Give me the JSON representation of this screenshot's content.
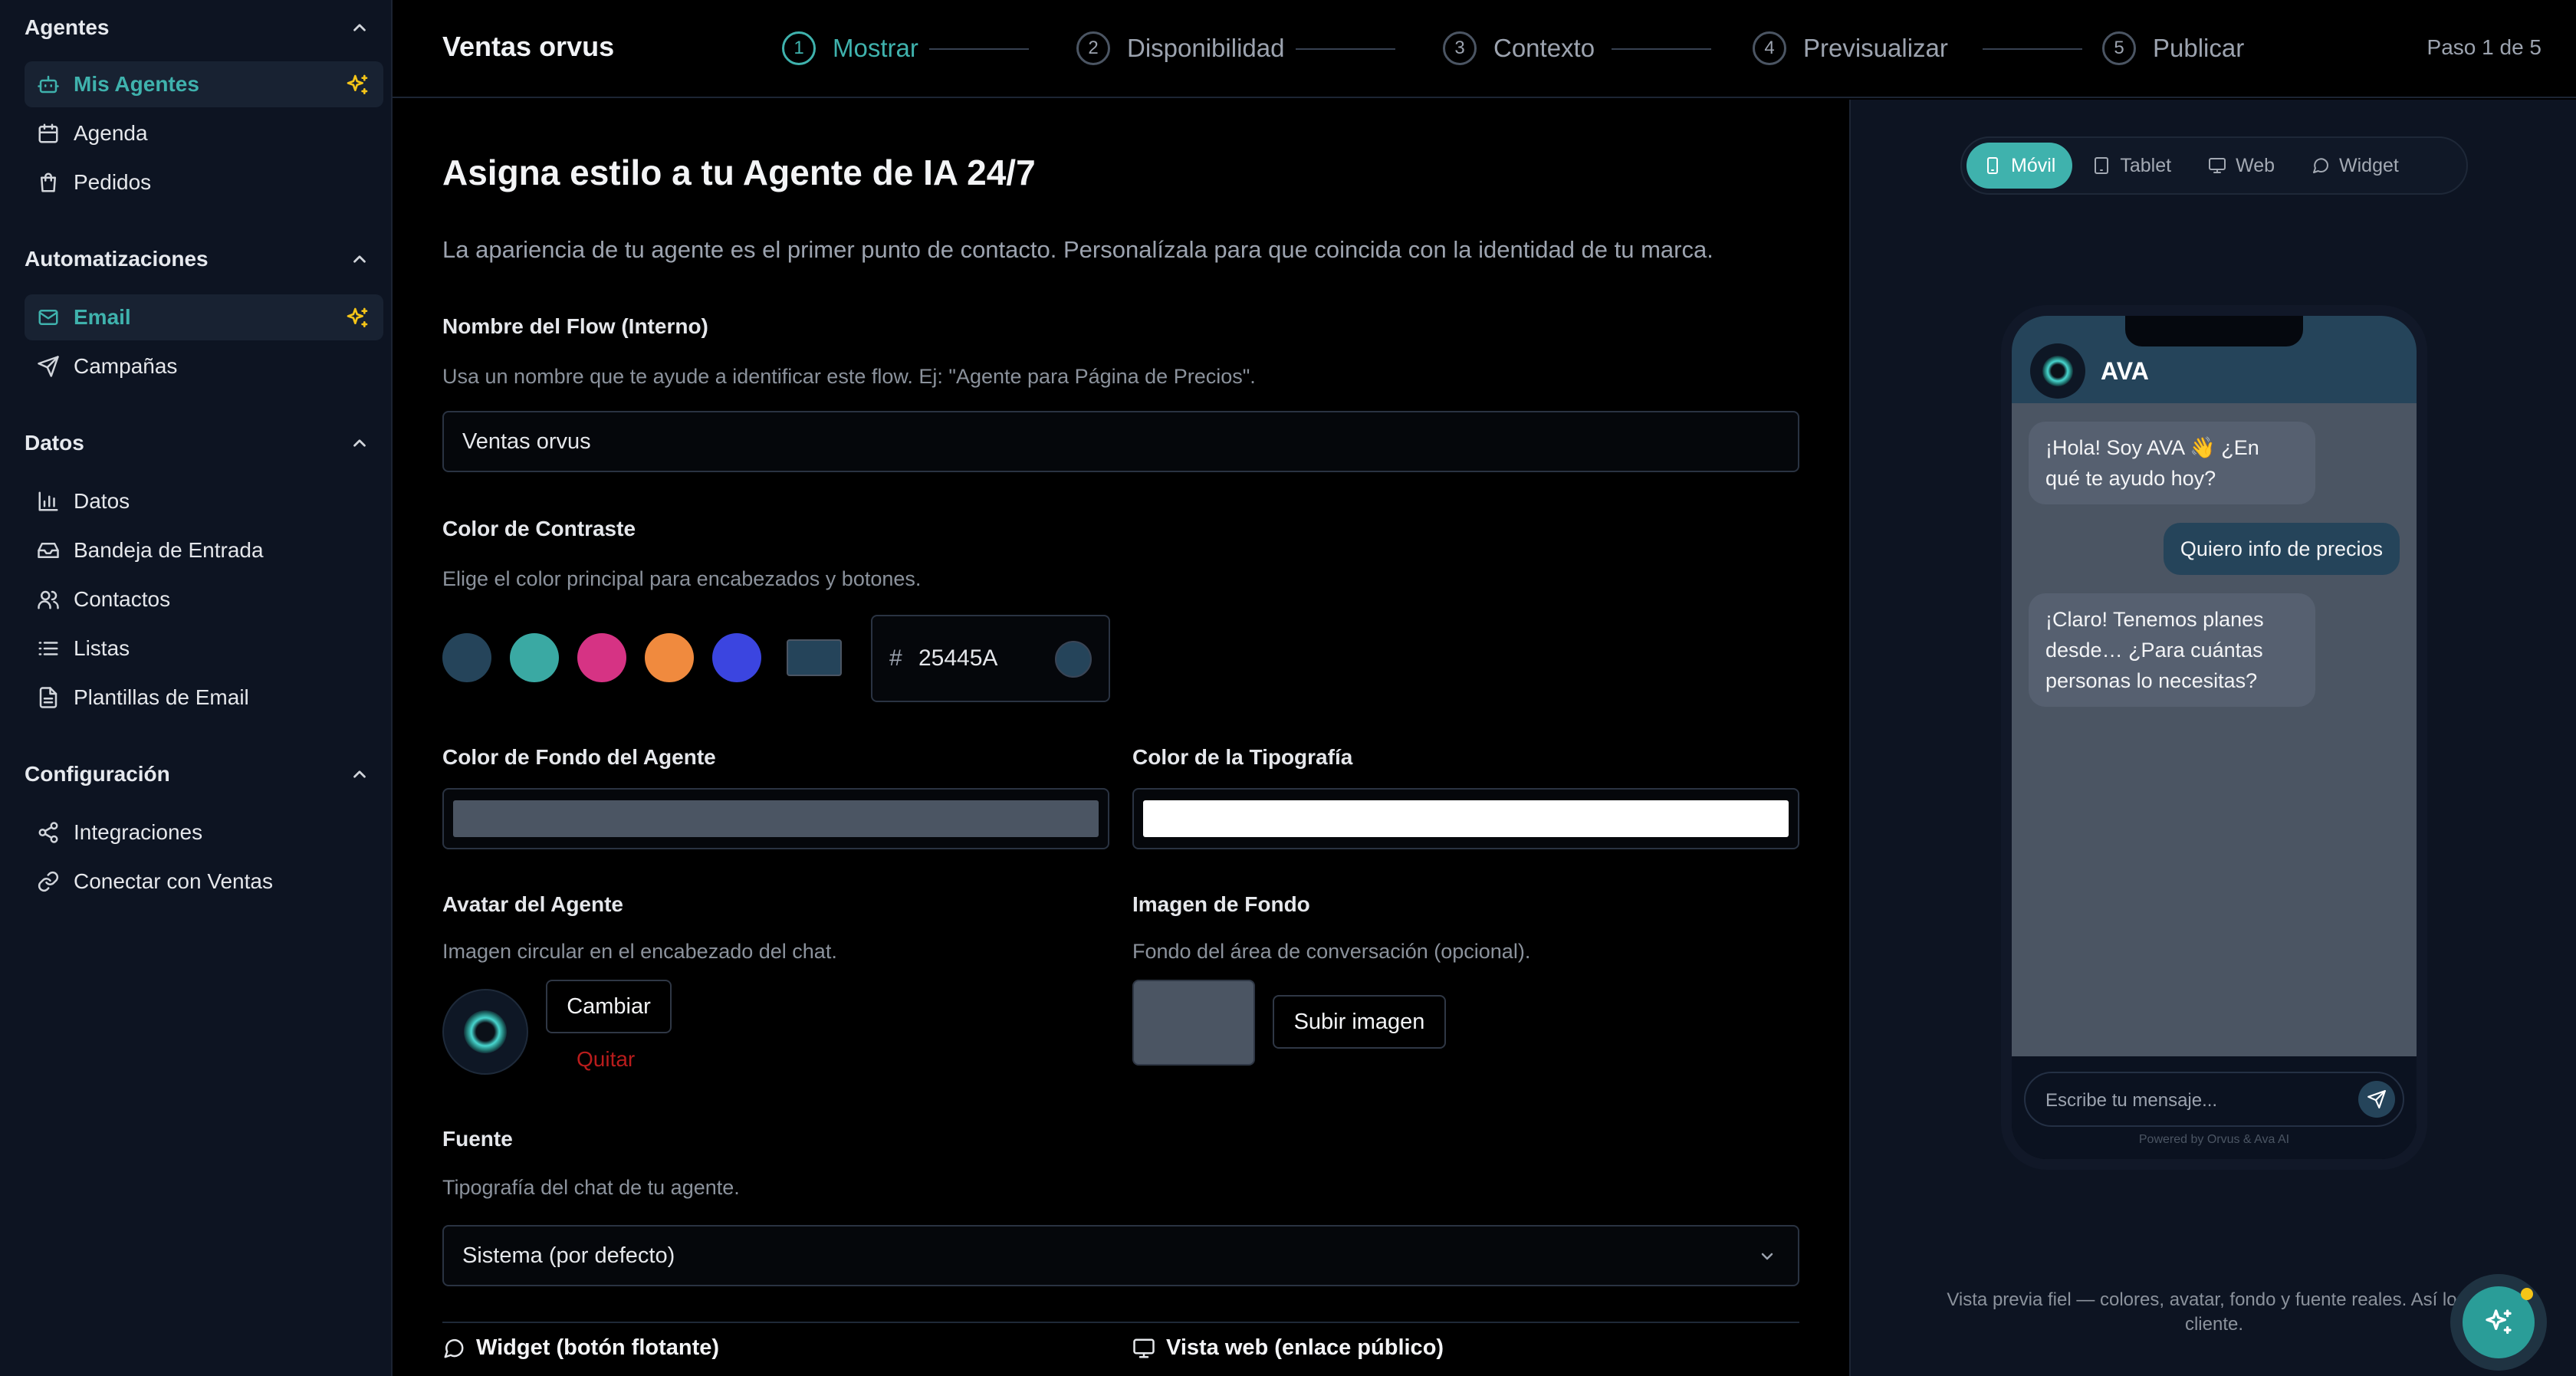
{
  "colors": {
    "accent": "#3fb2ad",
    "contrast": "#25445a",
    "agent_bg": "#4b5563",
    "typography": "#ffffff",
    "remove": "#b91c1c",
    "spark": "#f5c518"
  },
  "sidebar": {
    "sections": [
      {
        "title": "Agentes",
        "items": [
          {
            "label": "Mis Agentes",
            "icon": "bot-icon",
            "active": true,
            "spark": true
          },
          {
            "label": "Agenda",
            "icon": "calendar-icon"
          },
          {
            "label": "Pedidos",
            "icon": "shopping-bag-icon"
          }
        ]
      },
      {
        "title": "Automatizaciones",
        "items": [
          {
            "label": "Email",
            "icon": "mail-icon",
            "active": true,
            "spark": true
          },
          {
            "label": "Campañas",
            "icon": "send-icon"
          }
        ]
      },
      {
        "title": "Datos",
        "items": [
          {
            "label": "Datos",
            "icon": "bar-chart-icon"
          },
          {
            "label": "Bandeja de Entrada",
            "icon": "inbox-icon"
          },
          {
            "label": "Contactos",
            "icon": "users-icon"
          },
          {
            "label": "Listas",
            "icon": "list-icon"
          },
          {
            "label": "Plantillas de Email",
            "icon": "file-text-icon"
          }
        ]
      },
      {
        "title": "Configuración",
        "items": [
          {
            "label": "Integraciones",
            "icon": "share-icon"
          },
          {
            "label": "Conectar con Ventas",
            "icon": "link-icon"
          }
        ]
      }
    ]
  },
  "topbar": {
    "title": "Ventas orvus",
    "steps": [
      {
        "num": "1",
        "label": "Mostrar",
        "active": true
      },
      {
        "num": "2",
        "label": "Disponibilidad"
      },
      {
        "num": "3",
        "label": "Contexto"
      },
      {
        "num": "4",
        "label": "Previsualizar"
      },
      {
        "num": "5",
        "label": "Publicar"
      }
    ],
    "step_count": "Paso 1 de 5"
  },
  "form": {
    "heading": "Asigna estilo a tu Agente de IA 24/7",
    "lead": "La apariencia de tu agente es el primer punto de contacto. Personalízala para que coincida con la identidad de tu marca.",
    "flow_name": {
      "label": "Nombre del Flow (Interno)",
      "help": "Usa un nombre que te ayude a identificar este flow. Ej: \"Agente para Página de Precios\".",
      "value": "Ventas orvus"
    },
    "contrast": {
      "label": "Color de Contraste",
      "help": "Elige el color principal para encabezados y botones.",
      "swatches": [
        "#25445a",
        "#3aa9a3",
        "#d63384",
        "#f08a3e",
        "#3b45e0"
      ],
      "hash": "#",
      "hex": "25445A"
    },
    "agent_bg": {
      "label": "Color de Fondo del Agente"
    },
    "typography": {
      "label": "Color de la Tipografía"
    },
    "avatar": {
      "label": "Avatar del Agente",
      "help": "Imagen circular en el encabezado del chat.",
      "change": "Cambiar",
      "remove": "Quitar"
    },
    "background_image": {
      "label": "Imagen de Fondo",
      "help": "Fondo del área de conversación (opcional).",
      "upload": "Subir imagen"
    },
    "font": {
      "label": "Fuente",
      "help": "Tipografía del chat de tu agente.",
      "value": "Sistema (por defecto)"
    },
    "modes": {
      "widget": "Widget (botón flotante)",
      "web": "Vista web (enlace público)"
    }
  },
  "preview": {
    "tabs": [
      {
        "label": "Móvil",
        "icon": "smartphone-icon",
        "active": true
      },
      {
        "label": "Tablet",
        "icon": "tablet-icon"
      },
      {
        "label": "Web",
        "icon": "monitor-icon"
      },
      {
        "label": "Widget",
        "icon": "message-circle-icon"
      }
    ],
    "agent_name": "AVA",
    "messages": [
      {
        "from": "bot",
        "lines": [
          "¡Hola! Soy AVA 👋 ¿En",
          "qué te ayudo hoy?"
        ]
      },
      {
        "from": "user",
        "lines": [
          "Quiero info de precios"
        ]
      },
      {
        "from": "bot",
        "lines": [
          "¡Claro! Tenemos planes",
          "desde… ¿Para cuántas",
          "personas lo necesitas?"
        ]
      }
    ],
    "composer_placeholder": "Escribe tu mensaje...",
    "powered_by": "Powered by Orvus & Ava AI",
    "footer_line1": "Vista previa fiel — colores, avatar, fondo y fuente reales. Así lo ve",
    "footer_line2": "cliente."
  }
}
